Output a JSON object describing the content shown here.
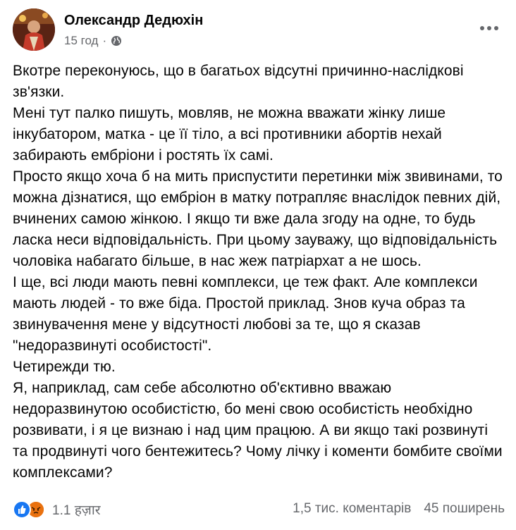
{
  "post": {
    "author": "Олександр Дедюхін",
    "time": "15 год",
    "separator": "·",
    "privacy_icon": "globe-icon",
    "more_icon": "ellipsis-icon",
    "paragraphs": [
      "Вкотре переконуюсь, що в багатьох відсутні причинно-наслідкові зв'язки.",
      "Мені тут палко пишуть, мовляв, не можна вважати жінку лише інкубатором, матка - це її тіло, а всі противники абортів нехай забирають ембріони і ростять їх самі.",
      "Просто якщо хоча б на мить приспустити перетинки між звивинами, то можна дізнатися,  що ембріон в матку потрапляє внаслідок певних дій, вчинених самою жінкою. І якщо ти вже дала згоду на одне, то будь ласка неси відповідальність. При цьому зауважу,  що відповідальність чоловіка набагато більше, в нас жеж патріархат а не шось.",
      "І ще, всі люди мають певні комплекси, це теж факт. Але комплекси мають людей - то вже біда. Простой приклад. Знов куча образ та звинувачення мене у відсутності любові за те, що я сказав \"недоразвинуті особистості\".",
      "Четирежди тю.",
      "Я, наприклад,  сам себе абсолютно об'єктивно вважаю недоразвинутою особистістю, бо мені свою особистість необхідно розвивати, і я це визнаю і над цим працюю. А ви якщо такі розвинуті та продвинуті чого бентежитесь? Чому лічку і коменти бомбите своїми комплексами?"
    ]
  },
  "footer": {
    "reaction_icons": [
      "like-icon",
      "angry-icon"
    ],
    "reaction_count": "1.1 हज़ार",
    "comments": "1,5 тис. коментарів",
    "shares": "45 поширень"
  },
  "colors": {
    "text": "#050505",
    "secondary": "#65676b",
    "like": "#1877f2",
    "angry": "#e9710f"
  }
}
